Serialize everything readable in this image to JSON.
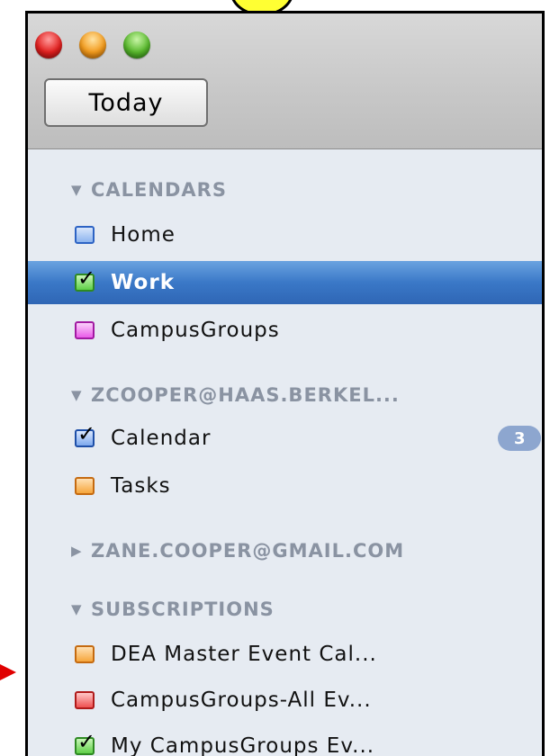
{
  "toolbar": {
    "today_label": "Today"
  },
  "sections": [
    {
      "title": "CALENDARS",
      "expanded": true,
      "items": [
        {
          "label": "Home",
          "color": "#5a8ee0",
          "checked": false,
          "selected": false
        },
        {
          "label": "Work",
          "color": "#4fbf3a",
          "checked": true,
          "selected": true
        },
        {
          "label": "CampusGroups",
          "color": "#e040e0",
          "checked": false,
          "selected": false
        }
      ]
    },
    {
      "title": "ZCOOPER@HAAS.BERKEL...",
      "expanded": true,
      "items": [
        {
          "label": "Calendar",
          "color": "#2f6bd8",
          "checked": true,
          "selected": false,
          "badge": "3"
        },
        {
          "label": "Tasks",
          "color": "#f39a2a",
          "checked": false,
          "selected": false
        }
      ]
    },
    {
      "title": "ZANE.COOPER@GMAIL.COM",
      "expanded": false,
      "items": []
    },
    {
      "title": "SUBSCRIPTIONS",
      "expanded": true,
      "items": [
        {
          "label": "DEA Master Event Cal...",
          "color": "#f39a2a",
          "checked": false,
          "selected": false
        },
        {
          "label": "CampusGroups-All Ev...",
          "color": "#e23a3a",
          "checked": false,
          "selected": false
        },
        {
          "label": "My CampusGroups Ev...",
          "color": "#4fbf3a",
          "checked": true,
          "selected": false
        }
      ]
    }
  ],
  "icons": {
    "expanded": "triangle-down-icon",
    "collapsed": "triangle-right-icon",
    "check": "checkmark-icon"
  },
  "colors": {
    "selection": "#3a78c7",
    "sidebar_bg": "#e6ebf2",
    "section_header": "#8a93a2",
    "annotation_arrow": "#e00000",
    "callout": "#ffff33"
  }
}
